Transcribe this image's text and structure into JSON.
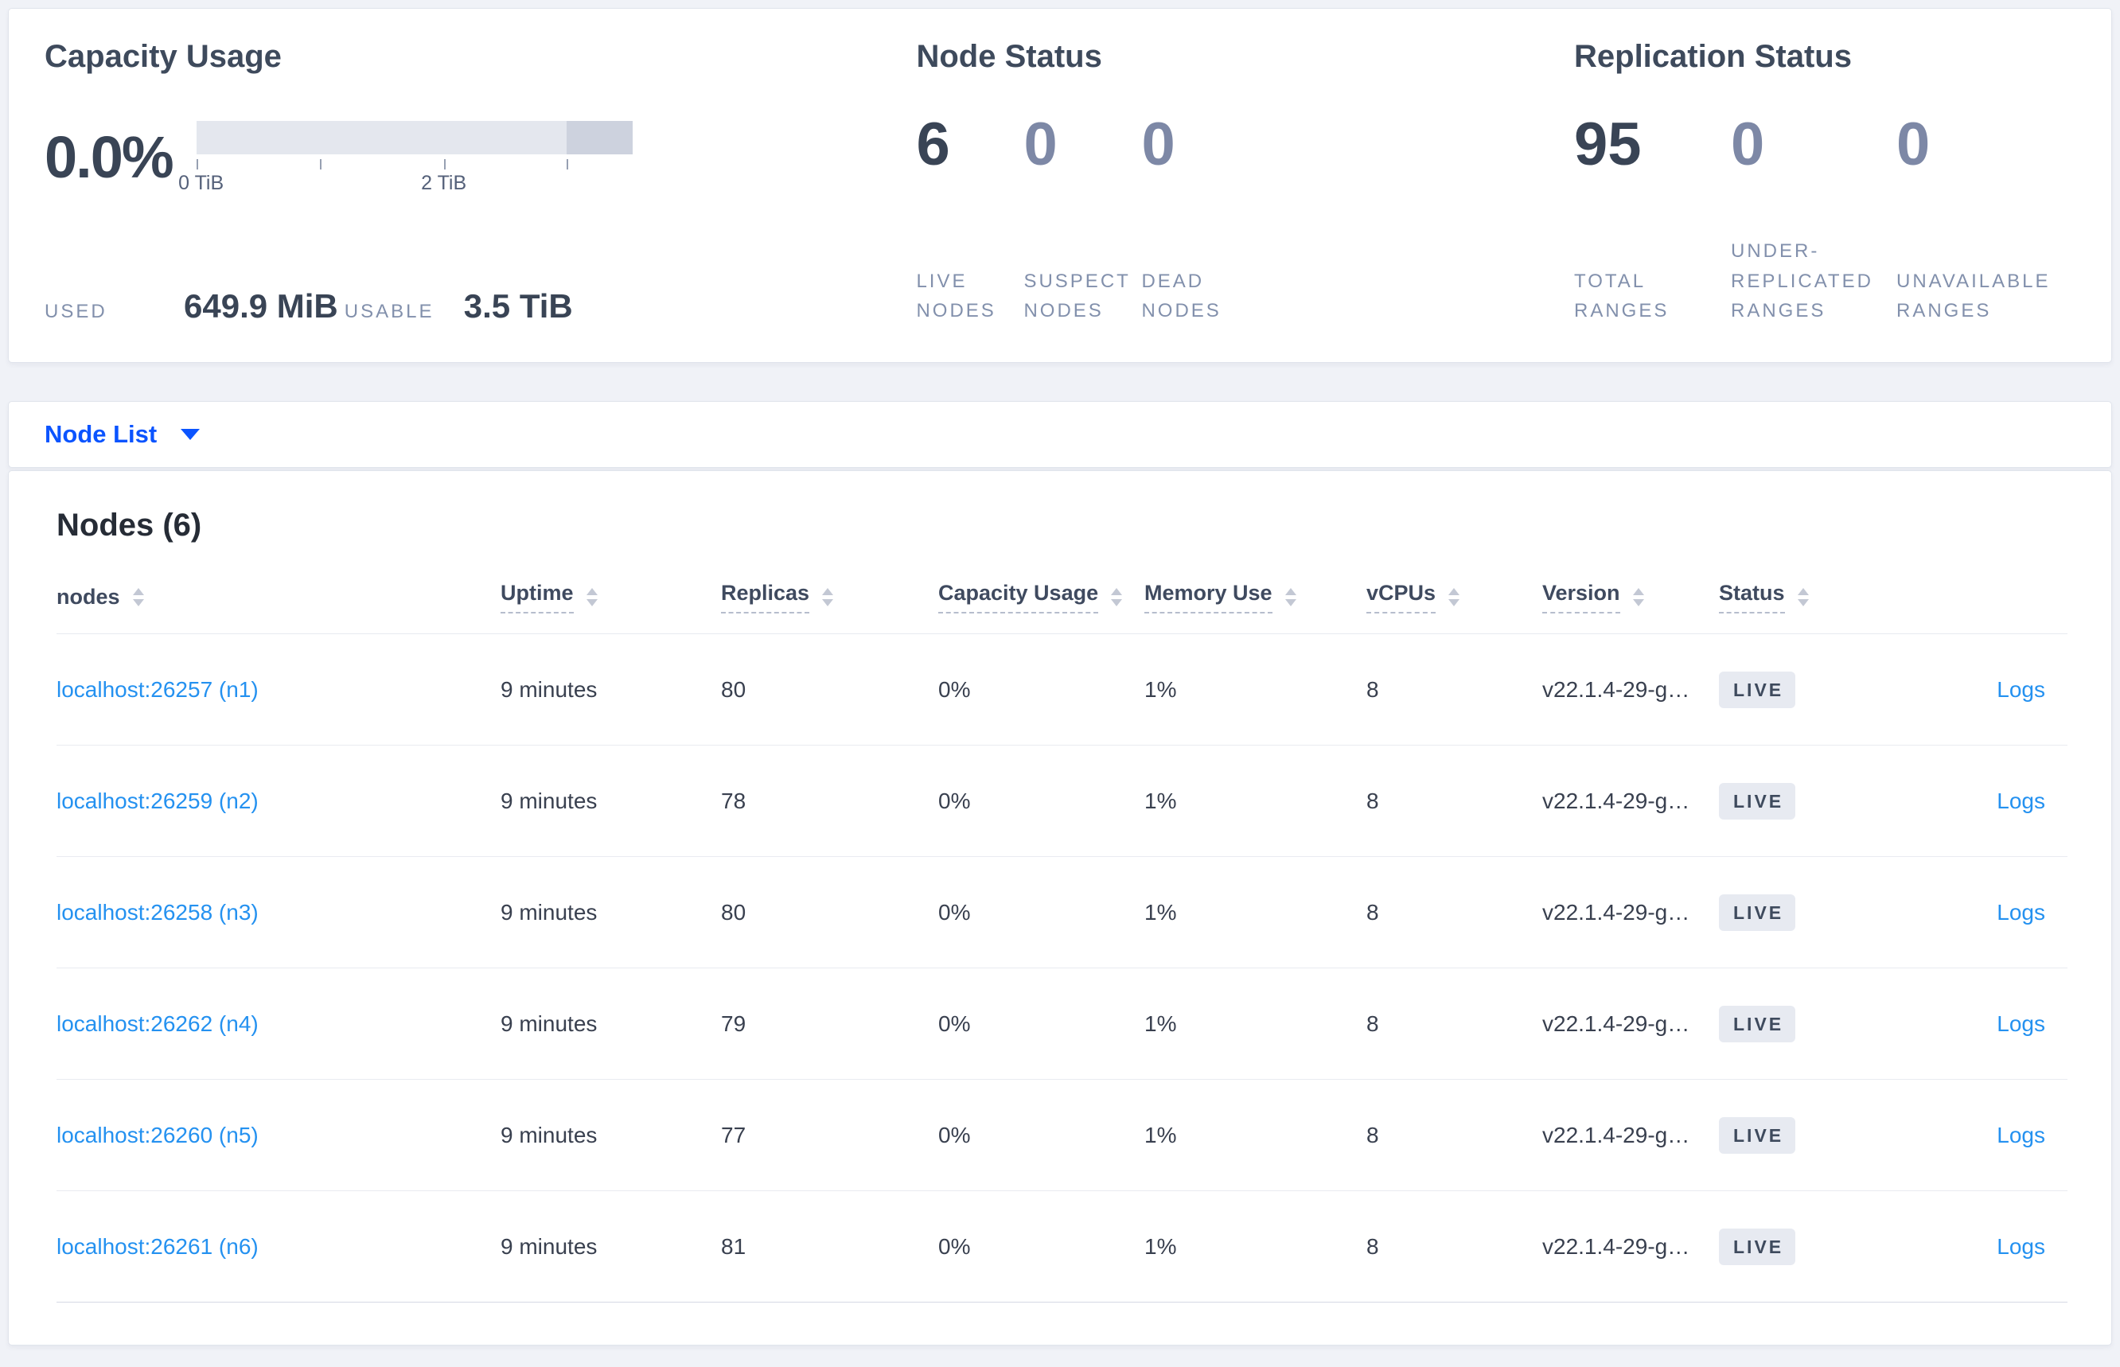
{
  "capacity": {
    "title": "Capacity Usage",
    "percent": "0.0%",
    "bar": {
      "range_ticks": [
        "0 TiB",
        "1 TiB",
        "2 TiB",
        "3 TiB"
      ],
      "visible_tick_labels": [
        "0 TiB",
        "2 TiB"
      ]
    },
    "used_label": "USED",
    "used_value": "649.9 MiB",
    "usable_label": "USABLE",
    "usable_value": "3.5 TiB"
  },
  "node_status": {
    "title": "Node Status",
    "stats": [
      {
        "value": "6",
        "label": "LIVE NODES"
      },
      {
        "value": "0",
        "label": "SUSPECT NODES"
      },
      {
        "value": "0",
        "label": "DEAD NODES"
      }
    ]
  },
  "replication_status": {
    "title": "Replication Status",
    "stats": [
      {
        "value": "95",
        "label": "TOTAL RANGES"
      },
      {
        "value": "0",
        "label": "UNDER-REPLICATED RANGES"
      },
      {
        "value": "0",
        "label": "UNAVAILABLE RANGES"
      }
    ]
  },
  "node_list": {
    "label": "Node List"
  },
  "nodes_table": {
    "title": "Nodes (6)",
    "logs_label": "Logs",
    "columns": [
      {
        "label": "nodes"
      },
      {
        "label": "Uptime"
      },
      {
        "label": "Replicas"
      },
      {
        "label": "Capacity Usage"
      },
      {
        "label": "Memory Use"
      },
      {
        "label": "vCPUs"
      },
      {
        "label": "Version"
      },
      {
        "label": "Status"
      }
    ],
    "rows": [
      {
        "node": "localhost:26257 (n1)",
        "uptime": "9 minutes",
        "replicas": "80",
        "capacity": "0%",
        "memory": "1%",
        "vcpus": "8",
        "version": "v22.1.4-29-g…",
        "status": "LIVE"
      },
      {
        "node": "localhost:26259 (n2)",
        "uptime": "9 minutes",
        "replicas": "78",
        "capacity": "0%",
        "memory": "1%",
        "vcpus": "8",
        "version": "v22.1.4-29-g…",
        "status": "LIVE"
      },
      {
        "node": "localhost:26258 (n3)",
        "uptime": "9 minutes",
        "replicas": "80",
        "capacity": "0%",
        "memory": "1%",
        "vcpus": "8",
        "version": "v22.1.4-29-g…",
        "status": "LIVE"
      },
      {
        "node": "localhost:26262 (n4)",
        "uptime": "9 minutes",
        "replicas": "79",
        "capacity": "0%",
        "memory": "1%",
        "vcpus": "8",
        "version": "v22.1.4-29-g…",
        "status": "LIVE"
      },
      {
        "node": "localhost:26260 (n5)",
        "uptime": "9 minutes",
        "replicas": "77",
        "capacity": "0%",
        "memory": "1%",
        "vcpus": "8",
        "version": "v22.1.4-29-g…",
        "status": "LIVE"
      },
      {
        "node": "localhost:26261 (n6)",
        "uptime": "9 minutes",
        "replicas": "81",
        "capacity": "0%",
        "memory": "1%",
        "vcpus": "8",
        "version": "v22.1.4-29-g…",
        "status": "LIVE"
      }
    ]
  },
  "colors": {
    "accent_blue": "#0b54ff",
    "link_blue": "#2491f0",
    "dark_slate": "#394455",
    "muted_slate": "#7d88a6",
    "badge_bg": "#e7eaf1",
    "gauge_track": "#e4e7ee",
    "gauge_dark_segment": "#cdd2de"
  }
}
